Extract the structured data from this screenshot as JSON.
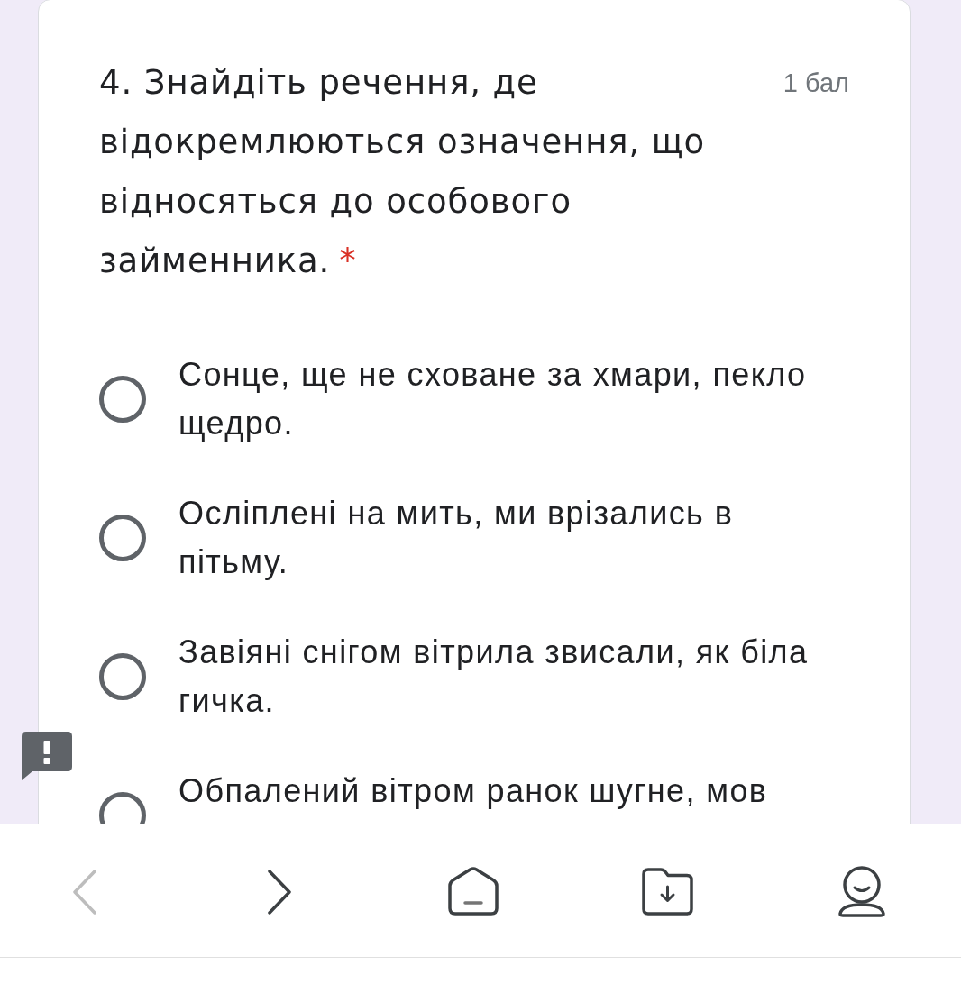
{
  "question": {
    "text": "4. Знайдіть речення, де відокремлюються означення, що відносяться до особового займенника.",
    "required_mark": "*",
    "points": "1 бал"
  },
  "options": [
    {
      "label": "Сонце, ще не сховане за хмари, пекло щедро.",
      "selected": false
    },
    {
      "label": "Осліплені на мить, ми врізались в пітьму.",
      "selected": false
    },
    {
      "label": "Завіяні снігом вітрила звисали, як біла гичка.",
      "selected": false
    },
    {
      "label": "Обпалений вітром ранок шугне, мов",
      "selected": false
    }
  ],
  "nav_bar": {
    "buttons": [
      {
        "kind": "back",
        "disabled": true
      },
      {
        "kind": "forward",
        "disabled": false
      },
      {
        "kind": "home",
        "disabled": false
      },
      {
        "kind": "downloads",
        "disabled": false
      },
      {
        "kind": "profile",
        "disabled": false
      }
    ]
  }
}
